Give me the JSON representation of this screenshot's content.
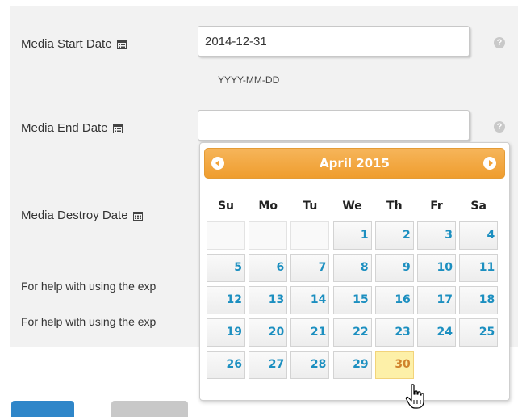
{
  "form": {
    "start_date": {
      "label": "Media Start Date",
      "value": "2014-12-31",
      "hint": "YYYY-MM-DD"
    },
    "end_date": {
      "label": "Media End Date",
      "value": ""
    },
    "destroy_date": {
      "label": "Media Destroy Date"
    },
    "help_mark": "?",
    "help_lines": [
      "For help with using the exp",
      "For help with using the exp"
    ]
  },
  "datepicker": {
    "month_title": "April 2015",
    "weekdays": [
      "Su",
      "Mo",
      "Tu",
      "We",
      "Th",
      "Fr",
      "Sa"
    ],
    "first_weekday_index": 3,
    "days_in_month": 30,
    "highlighted_day": 30,
    "accent_color": "#f2a237",
    "day_color": "#1c8fc0",
    "highlight_color": "#fdf0a8"
  },
  "icons": {
    "calendar": "calendar-icon",
    "help": "help-icon",
    "prev": "prev-month-icon",
    "next": "next-month-icon",
    "cursor": "hand-pointer-icon"
  }
}
